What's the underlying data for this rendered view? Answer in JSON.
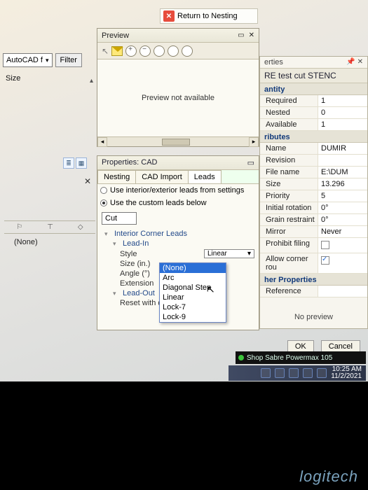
{
  "return_bar": {
    "label": "Return to Nesting"
  },
  "left": {
    "fontcombo": "AutoCAD f",
    "filter_btn": "Filter",
    "size_label": "Size",
    "none": "(None)"
  },
  "preview": {
    "title": "Preview",
    "body": "Preview not available"
  },
  "props": {
    "title": "Properties: CAD",
    "tabs": [
      "Nesting",
      "CAD Import",
      "Leads"
    ],
    "radio1": "Use interior/exterior leads from settings",
    "radio2": "Use the custom leads below",
    "cut": "Cut",
    "section": "Interior Corner Leads",
    "leadin": "Lead-In",
    "style": "Style",
    "style_val": "Linear",
    "size": "Size (in.)",
    "angle": "Angle (°)",
    "extension": "Extension",
    "leadout": "Lead-Out",
    "reset": "Reset with d",
    "dropdown": [
      "(None)",
      "Arc",
      "Diagonal Step",
      "Linear",
      "Lock-7",
      "Lock-9"
    ]
  },
  "side": {
    "tab": "erties",
    "title": "RE test cut STENC",
    "sec_quantity": "antity",
    "rows_qty": [
      {
        "k": "Required",
        "v": "1"
      },
      {
        "k": "Nested",
        "v": "0"
      },
      {
        "k": "Available",
        "v": "1"
      }
    ],
    "sec_attr": "ributes",
    "rows_attr": [
      {
        "k": "Name",
        "v": "DUMIR"
      },
      {
        "k": "Revision",
        "v": ""
      },
      {
        "k": "File name",
        "v": "E:\\DUM"
      },
      {
        "k": "Size",
        "v": "13.296"
      },
      {
        "k": "Priority",
        "v": "5"
      },
      {
        "k": "Initial rotation",
        "v": "0°"
      },
      {
        "k": "Grain restraint",
        "v": "0°"
      },
      {
        "k": "Mirror",
        "v": "Never"
      },
      {
        "k": "Prohibit filing",
        "v": ""
      },
      {
        "k": "Allow corner rou",
        "v": "check"
      }
    ],
    "sec_other": "her Properties",
    "ref": "Reference",
    "nopreview": "No preview",
    "ok": "OK",
    "cancel": "Cancel"
  },
  "toast": "Shop Sabre Powermax 105",
  "clock": {
    "time": "10:25 AM",
    "date": "11/2/2021"
  },
  "brand": "logitech"
}
